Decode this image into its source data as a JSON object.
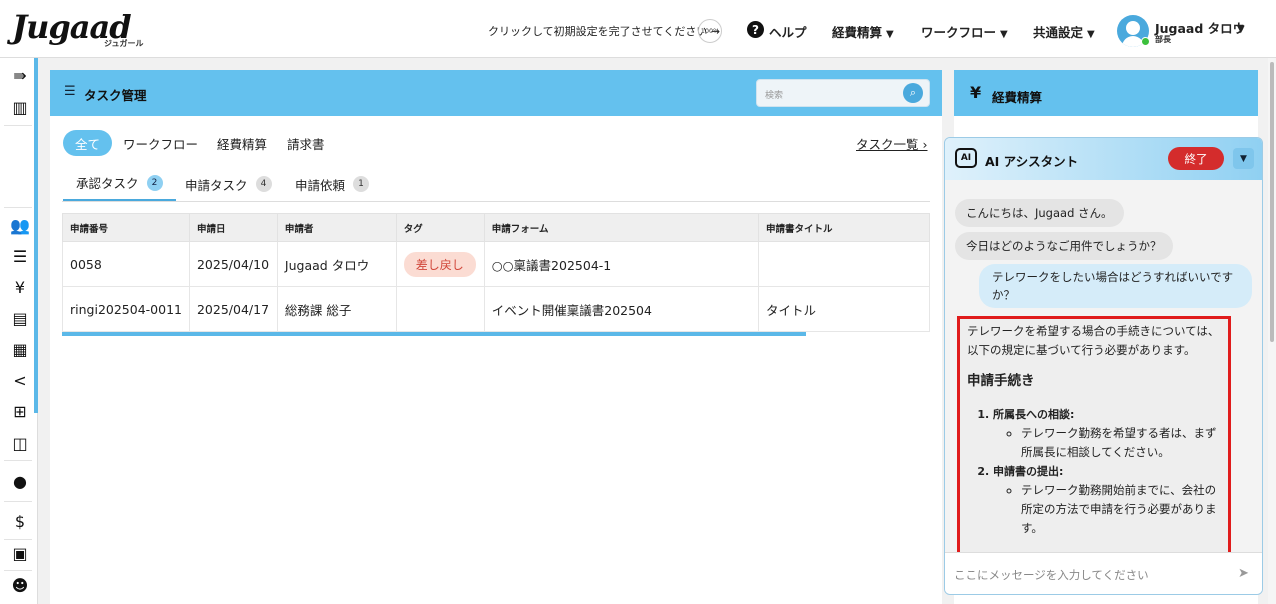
{
  "header": {
    "logo": "Jugaad",
    "logo_sub": "ジュガール",
    "setup_text": "クリックして初期設定を完了させてください →",
    "setup_progress": "100%",
    "help": "ヘルプ",
    "nav": [
      "経費精算",
      "ワークフロー",
      "共通設定"
    ],
    "user_name": "Jugaad タロウ",
    "user_role": "部長"
  },
  "sidebar": {
    "icons": [
      "menu-expand-icon",
      "building-icon",
      "users-icon",
      "list-icon",
      "yen-icon",
      "document-icon",
      "receipt-icon",
      "share-icon",
      "grid-icon",
      "book-icon",
      "ai-chat-icon",
      "invoice-icon",
      "manual-icon",
      "support-icon"
    ]
  },
  "task_panel": {
    "title": "タスク管理",
    "search_placeholder": "検索",
    "category_tabs": [
      "全て",
      "ワークフロー",
      "経費精算",
      "請求書"
    ],
    "task_list_link": "タスク一覧",
    "sub_tabs": [
      {
        "label": "承認タスク",
        "count": "2"
      },
      {
        "label": "申請タスク",
        "count": "4"
      },
      {
        "label": "申請依頼",
        "count": "1"
      }
    ],
    "columns": [
      "申請番号",
      "申請日",
      "申請者",
      "タグ",
      "申請フォーム",
      "申請書タイトル"
    ],
    "rows": [
      {
        "id": "0058",
        "date": "2025/04/10",
        "applicant": "Jugaad タロウ",
        "tag": "差し戻し",
        "form": "○○稟議書202504-1",
        "title": ""
      },
      {
        "id": "ringi202504-0011",
        "date": "2025/04/17",
        "applicant": "総務課 総子",
        "tag": "",
        "form": "イベント開催稟議書202504",
        "title": "タイトル"
      }
    ]
  },
  "expense_panel": {
    "title": "経費精算"
  },
  "ai_panel": {
    "title": "AI アシスタント",
    "end_button": "終了",
    "messages": [
      "こんにちは、Jugaad さん。",
      "今日はどのようなご用件でしょうか？",
      "テレワークをしたい場合はどうすればいいですか？"
    ],
    "answer": {
      "intro": "テレワークを希望する場合の手続きについては、以下の規定に基づいて行う必要があります。",
      "heading": "申請手続き",
      "steps": [
        {
          "title": "所属長への相談:",
          "detail": "テレワーク勤務を希望する者は、まず所属長に相談してください。"
        },
        {
          "title": "申請書の提出:",
          "detail": "テレワーク勤務開始前までに、会社の所定の方法で申請を行う必要があります。"
        }
      ]
    },
    "input_placeholder": "ここにメッセージを入力してください"
  },
  "colors": {
    "accent": "#64c1ee",
    "link": "#2a7ec0",
    "danger": "#d42c2c",
    "tag_bg": "#fbdcd3"
  }
}
